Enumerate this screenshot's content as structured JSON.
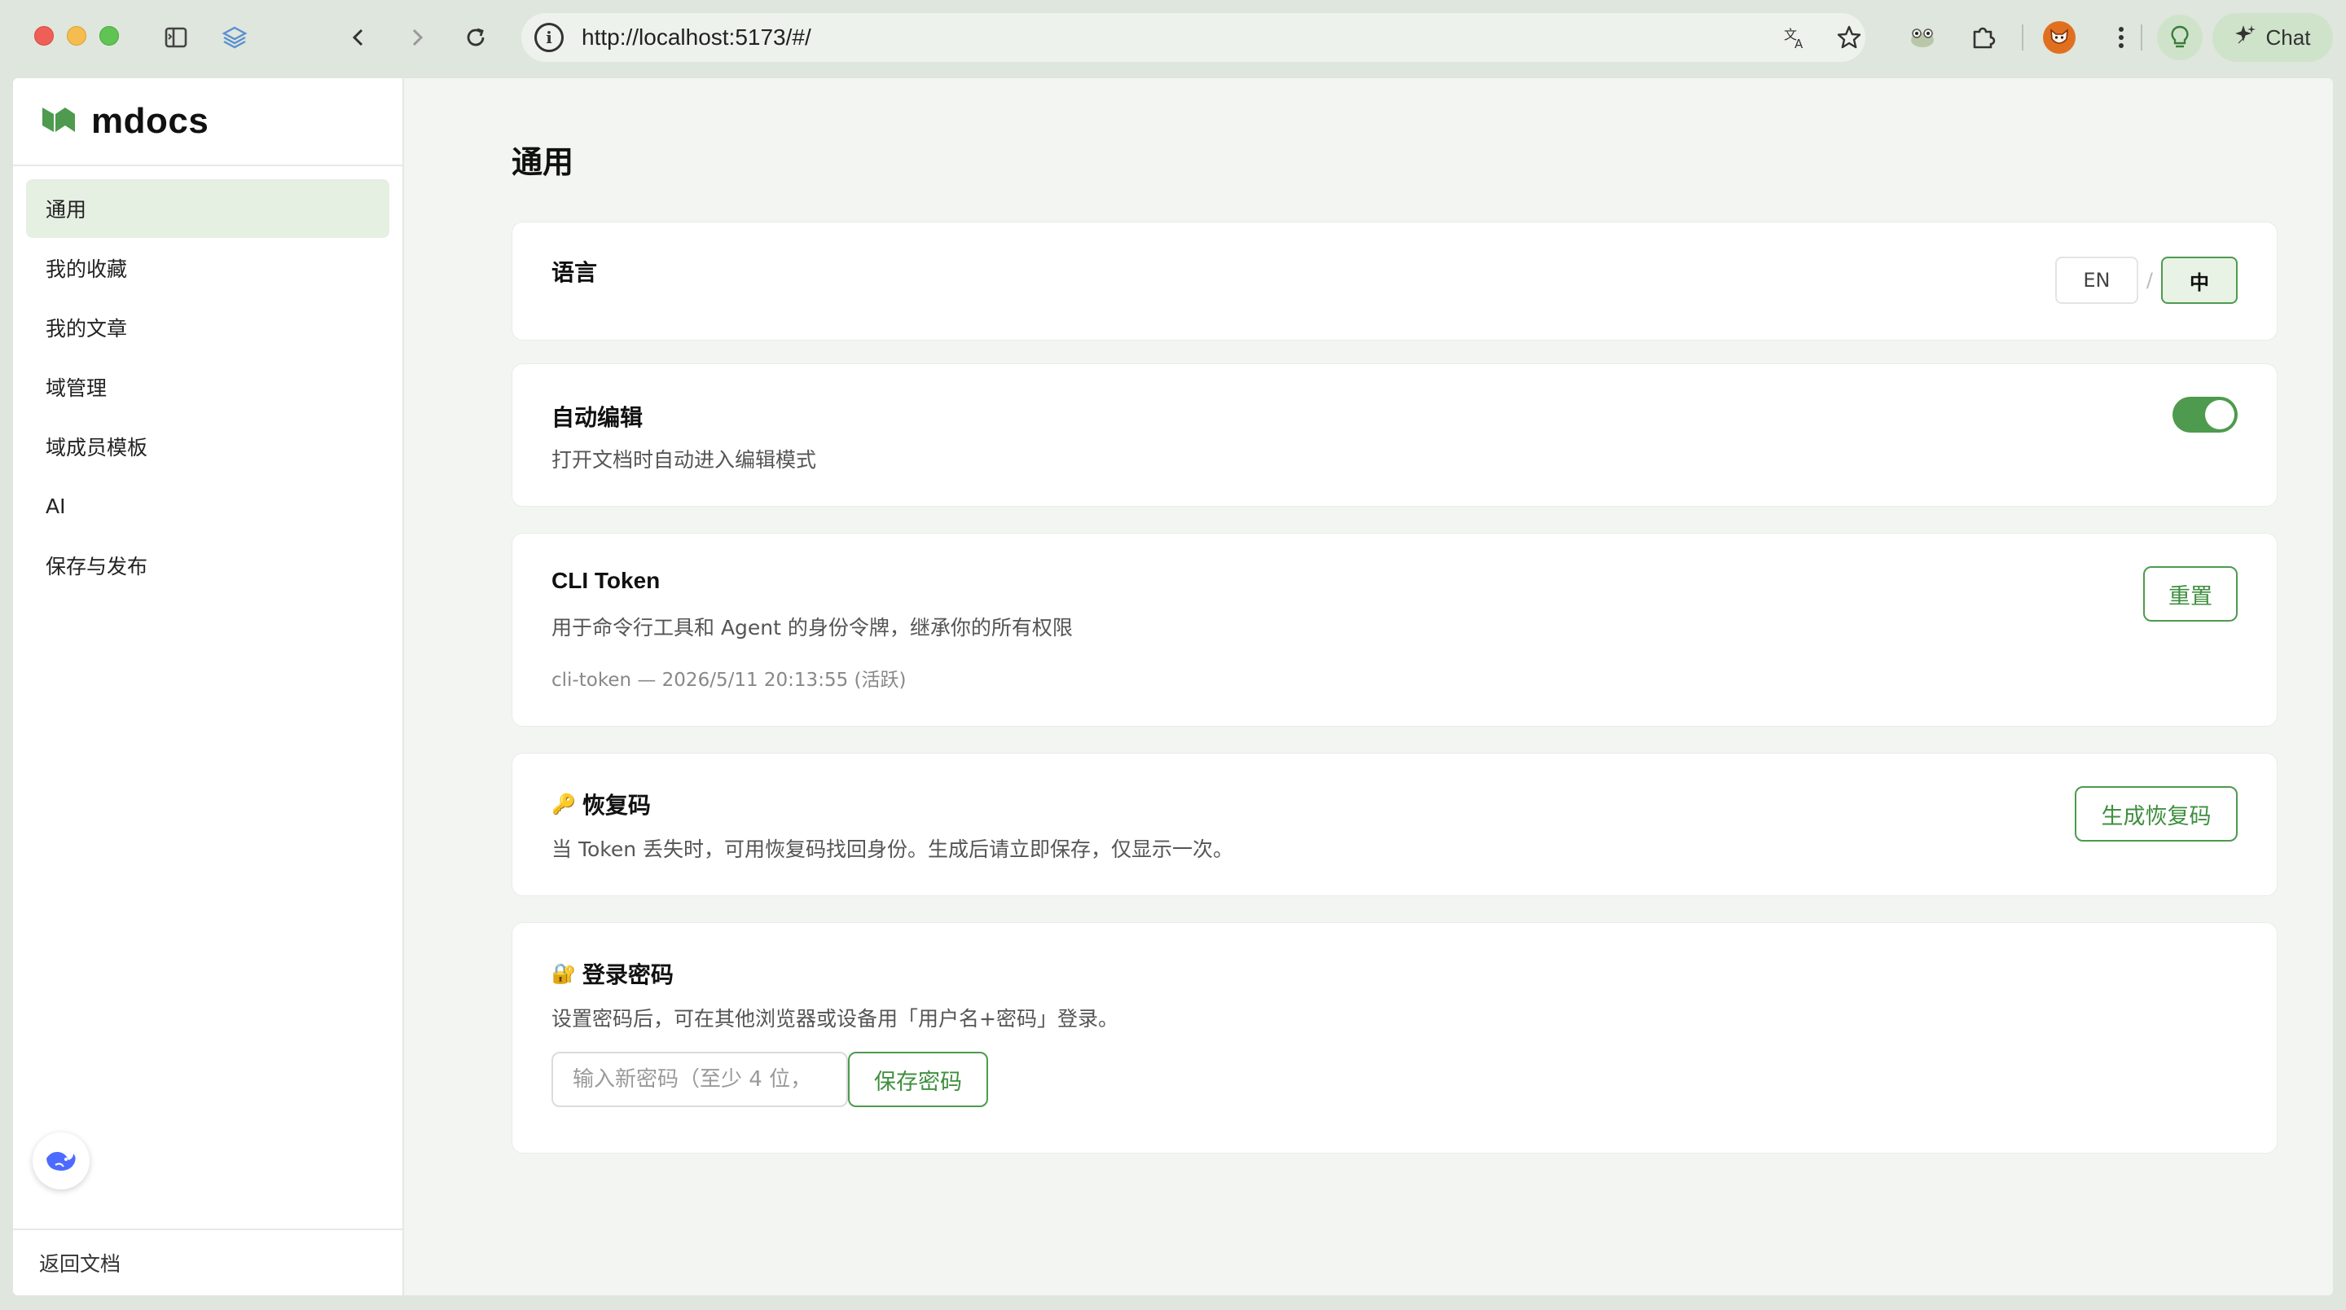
{
  "browser": {
    "url": "http://localhost:5173/#/",
    "chat_label": "Chat",
    "icons": {
      "sidebar_toggle": "sidebar-toggle-icon",
      "layers": "layers-icon",
      "back": "back-arrow-icon",
      "forward": "forward-arrow-icon",
      "reload": "reload-icon",
      "site_info": "site-info-icon",
      "translate": "translate-icon",
      "bookmark": "star-icon",
      "extension_frog": "frog-extension-icon",
      "extensions": "puzzle-icon",
      "profile": "fox-avatar-icon",
      "menu": "kebab-menu-icon",
      "bulb": "lightbulb-icon",
      "chat": "chat-spark-icon"
    },
    "colors": {
      "accent": "#cfe3cb",
      "chrome": "#dfe6dd"
    }
  },
  "sidebar": {
    "brand": "mdocs",
    "items": [
      {
        "label": "通用",
        "active": true
      },
      {
        "label": "我的收藏",
        "active": false
      },
      {
        "label": "我的文章",
        "active": false
      },
      {
        "label": "域管理",
        "active": false
      },
      {
        "label": "域成员模板",
        "active": false
      },
      {
        "label": "AI",
        "active": false
      },
      {
        "label": "保存与发布",
        "active": false
      }
    ],
    "footer": "返回文档"
  },
  "main": {
    "title": "通用",
    "language": {
      "title": "语言",
      "options": [
        "EN",
        "中"
      ],
      "selected": "中"
    },
    "auto_edit": {
      "title": "自动编辑",
      "desc": "打开文档时自动进入编辑模式",
      "enabled": true
    },
    "cli_token": {
      "title": "CLI Token",
      "desc": "用于命令行工具和 Agent 的身份令牌，继承你的所有权限",
      "meta": "cli-token — 2026/5/11 20:13:55 (活跃)",
      "reset_label": "重置"
    },
    "recovery": {
      "icon": "🔑",
      "title": "恢复码",
      "desc": "当 Token 丢失时，可用恢复码找回身份。生成后请立即保存，仅显示一次。",
      "button": "生成恢复码"
    },
    "password": {
      "icon": "🔐",
      "title": "登录密码",
      "desc": "设置密码后，可在其他浏览器或设备用「用户名+密码」登录。",
      "placeholder": "输入新密码（至少 4 位，",
      "value": "",
      "button": "保存密码"
    }
  },
  "colors": {
    "primary": "#4e9a4e",
    "active_bg": "#e5efe2"
  }
}
